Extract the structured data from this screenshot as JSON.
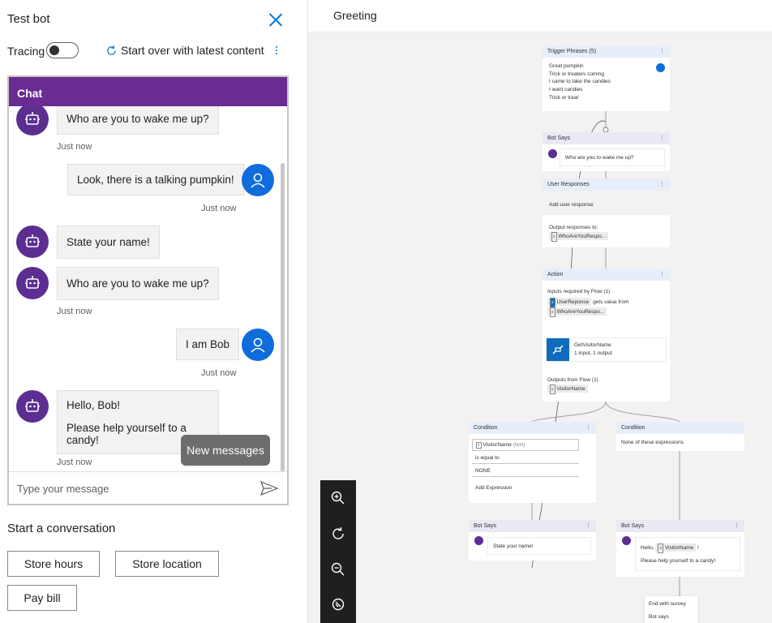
{
  "panel": {
    "title": "Test bot",
    "tracing_label": "Tracing",
    "tracing_on": false,
    "restart_label": "Start over with latest content"
  },
  "chat": {
    "header": "Chat",
    "messages": [
      {
        "from": "bot",
        "text": "Who are you to wake me up?",
        "time": "Just now"
      },
      {
        "from": "user",
        "text": "Look, there is a talking pumpkin!",
        "time": "Just now"
      },
      {
        "from": "bot",
        "text": "State your name!",
        "time": ""
      },
      {
        "from": "bot",
        "text": "Who are you to wake me up?",
        "time": "Just now"
      },
      {
        "from": "user",
        "text": "I am Bob",
        "time": "Just now"
      },
      {
        "from": "bot",
        "text": "Hello, Bob!",
        "text2": "Please help yourself to a candy!",
        "time": "Just now"
      }
    ],
    "new_messages": "New messages",
    "input_placeholder": "Type your message"
  },
  "start_conversation": {
    "title": "Start a conversation",
    "buttons": [
      "Store hours",
      "Store location",
      "Pay bill"
    ]
  },
  "canvas": {
    "title": "Greeting",
    "trigger": {
      "title": "Trigger Phrases (5)",
      "phrases": [
        "Great pumpkin",
        "Trick or treaters coming",
        "I came to take the candies",
        "I want candies",
        "Trick or treat"
      ]
    },
    "bot_says_1": {
      "title": "Bot Says",
      "text": "Who are you to wake me up?"
    },
    "user_responses": {
      "title": "User Responses",
      "add": "Add user response",
      "output_label": "Output responses to:",
      "variable": "WhoAreYouRespo..."
    },
    "action": {
      "title": "Action",
      "inputs_label": "Inputs required by Flow (1)",
      "input_var": "UserReponse",
      "gets_value": "gets value from",
      "source_var": "WhoAreYouRespo...",
      "flow_name": "GetVisitorName",
      "flow_io": "1 input, 1 output",
      "outputs_label": "Outputs from Flow (1)",
      "output_var": "VisitorName"
    },
    "condition_1": {
      "title": "Condition",
      "var": "VisitorName",
      "var_type": "(text)",
      "operator": "is equal to",
      "value": "NONE",
      "add_expression": "Add Expression"
    },
    "condition_2": {
      "title": "Condition",
      "text": "None of these expressions"
    },
    "bot_says_2": {
      "title": "Bot Says",
      "text": "State your name!"
    },
    "bot_says_3": {
      "title": "Bot Says",
      "text_prefix": "Hello,",
      "var": "VisitorName",
      "text_suffix": "!",
      "text2": "Please help yourself to a candy!"
    },
    "menu": [
      "End with survey",
      "Bot says"
    ]
  },
  "icons": {
    "close": "close-icon",
    "restart": "refresh-icon",
    "more": "more-vertical-icon",
    "bot": "bot-icon",
    "user": "person-icon",
    "send": "send-icon",
    "zoom_in": "zoom-in-icon",
    "reset": "reset-icon",
    "zoom_out": "zoom-out-icon",
    "fit": "compass-icon"
  },
  "colors": {
    "chat_header": "#6b2c91",
    "bot_avatar": "#5c2e91",
    "user_avatar": "#0f6cdb",
    "accent": "#0078d4",
    "canvas_bg": "#f3f2f1"
  }
}
